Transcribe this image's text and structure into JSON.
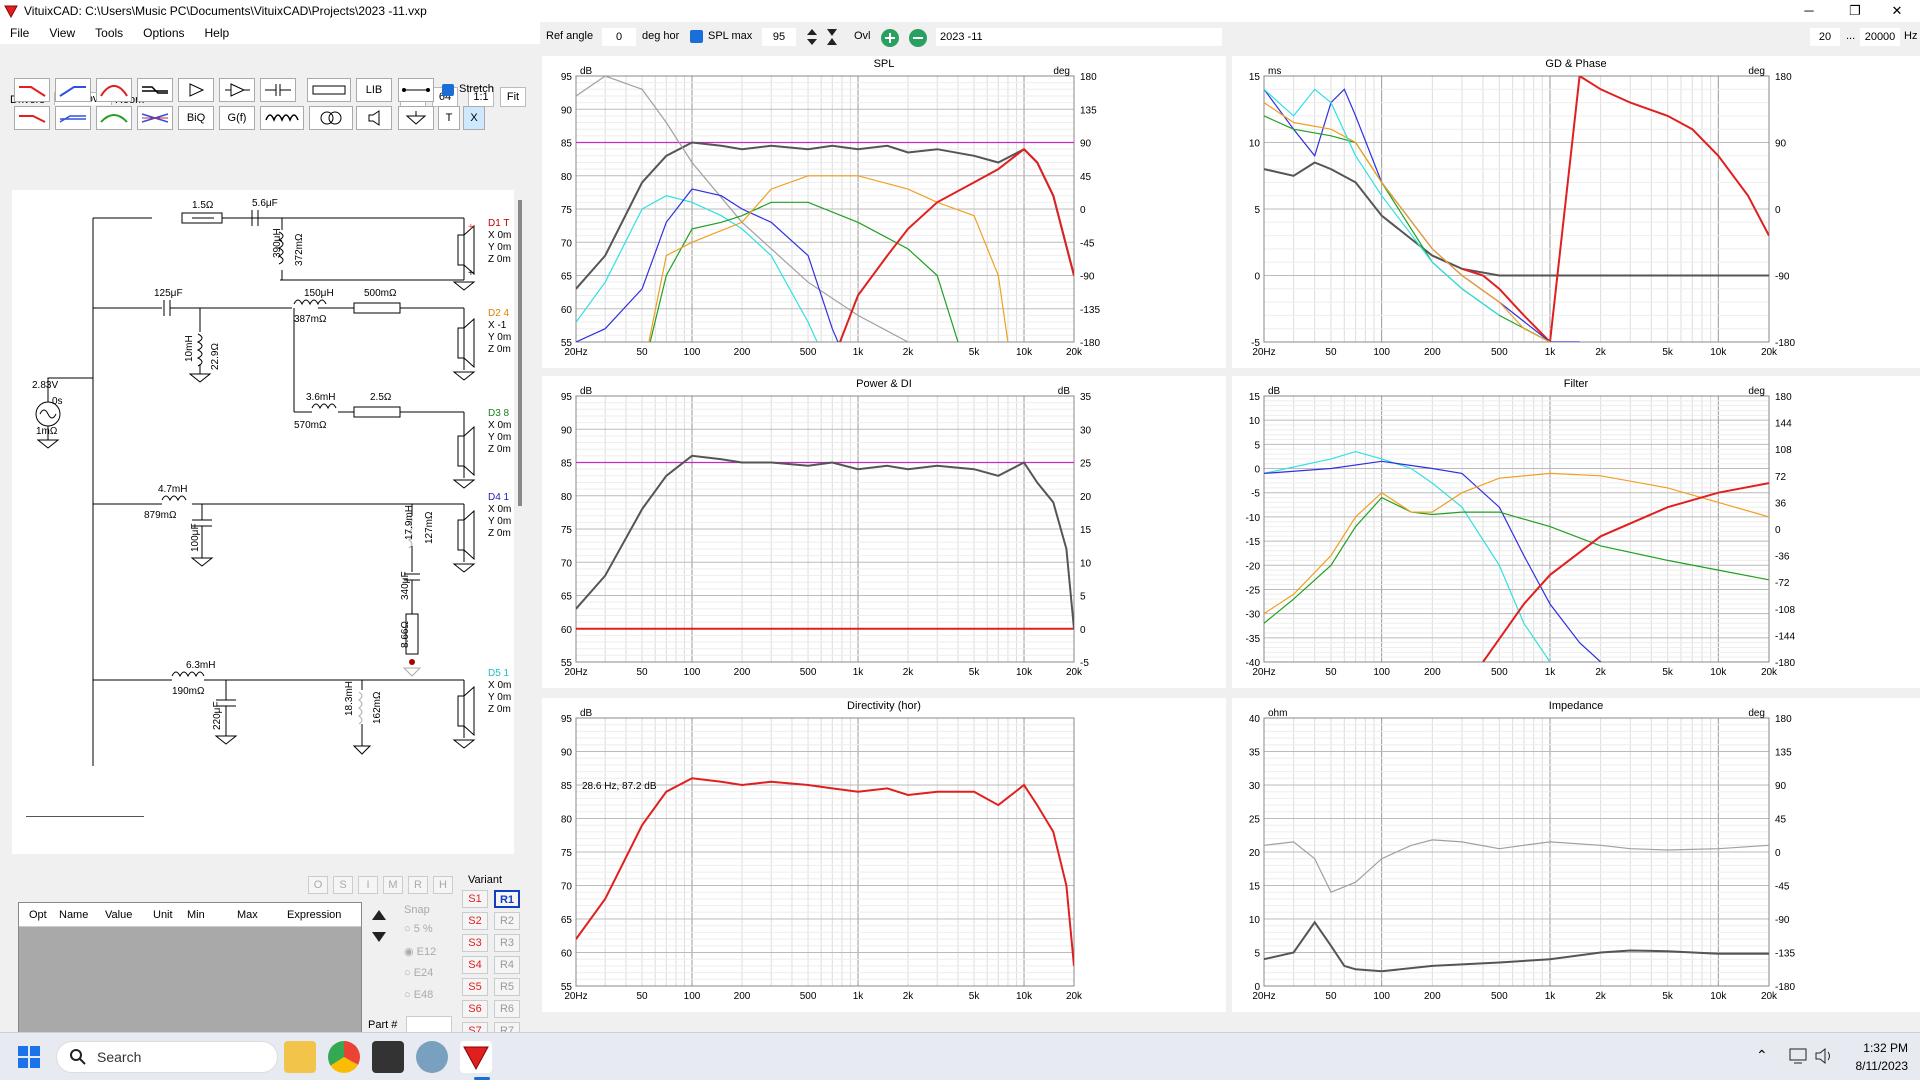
{
  "app": {
    "title": "VituixCAD: C:\\Users\\Music PC\\Documents\\VituixCAD\\Projects\\2023 -11.vxp",
    "min": "─",
    "max": "❐",
    "close": "✕"
  },
  "menu": [
    "File",
    "View",
    "Tools",
    "Options",
    "Help"
  ],
  "tabs": [
    "Drivers",
    "Crossover",
    "Room"
  ],
  "viewbtns": [
    "9",
    "64",
    "1:1",
    "Fit"
  ],
  "tools": {
    "lib": "LIB",
    "biq": "BiQ",
    "gf": "G(f)",
    "t": "T",
    "x": "X",
    "stretch": "Stretch"
  },
  "schematic": {
    "source": {
      "v": "2.83V",
      "t": "0s",
      "r": "1mΩ"
    },
    "d1": {
      "r": "1.5Ω",
      "c": "5.6μF",
      "l": "390μH",
      "lr": "372mΩ",
      "label": "D1 T",
      "xyz": [
        "X 0m",
        "Y 0m",
        "Z 0m"
      ]
    },
    "d2": {
      "c": "125μF",
      "l": "10mH",
      "lr": "22.9Ω",
      "l2": "150μH",
      "l2r": "387mΩ",
      "r": "500mΩ",
      "label": "D2 4",
      "xyz": [
        "X -1",
        "Y 0m",
        "Z 0m"
      ]
    },
    "d3": {
      "l": "3.6mH",
      "lr": "570mΩ",
      "r": "2.5Ω",
      "label": "D3 8",
      "xyz": [
        "X 0m",
        "Y 0m",
        "Z 0m"
      ]
    },
    "d4": {
      "l": "4.7mH",
      "lr": "879mΩ",
      "c": "100μF",
      "l2": "17.9mH",
      "l2r": "127mΩ",
      "c2": "340μF",
      "r": "8.66Ω",
      "label": "D4 1",
      "xyz": [
        "X 0m",
        "Y 0m",
        "Z 0m"
      ]
    },
    "d5": {
      "l": "6.3mH",
      "lr": "190mΩ",
      "c": "220μF",
      "l2": "18.3mH",
      "l2r": "162mΩ",
      "label": "D5 1",
      "xyz": [
        "X 0m",
        "Y 0m",
        "Z 0m"
      ]
    }
  },
  "opt": {
    "headers": [
      "Opt",
      "Name",
      "Value",
      "Unit",
      "Min",
      "Max",
      "Expression"
    ],
    "toggles": [
      "O",
      "S",
      "I",
      "M",
      "R",
      "H"
    ],
    "snap": "Snap",
    "snapopts": [
      "5 %",
      "E12",
      "E24",
      "E48"
    ],
    "part": "Part #",
    "variant": "Variant",
    "s": [
      "S1",
      "S2",
      "S3",
      "S4",
      "S5",
      "S6",
      "S7",
      "S8"
    ],
    "r": [
      "R1",
      "R2",
      "R3",
      "R4",
      "R5",
      "R6",
      "R7",
      "R8"
    ]
  },
  "toolbar": {
    "refangle_label": "Ref angle",
    "refangle": "0",
    "deghor": "deg hor",
    "splmax_label": "SPL max",
    "splmax": "95",
    "ovl": "Ovl",
    "name": "2023 -11",
    "fmin": "20",
    "dots": "...",
    "fmax": "20000",
    "hz": "Hz"
  },
  "colors": {
    "magenta": "#c030c0",
    "red": "#e02020",
    "darkgray": "#555",
    "gray": "#a0a0a0",
    "cyan": "#30e0e0",
    "blue": "#3030e0",
    "green": "#20a020",
    "orange": "#f0a020"
  },
  "chart_data": [
    {
      "type": "line",
      "title": "SPL",
      "ylabel": "dB",
      "y2label": "deg",
      "x_ticks": [
        "20Hz",
        "50",
        "100",
        "200",
        "500",
        "1k",
        "2k",
        "5k",
        "10k",
        "20k"
      ],
      "ylim": [
        55,
        95
      ],
      "y2lim": [
        -180,
        180
      ],
      "y_ticks": [
        "95",
        "90",
        "85",
        "80",
        "75",
        "70",
        "65",
        "60",
        "55"
      ],
      "y2_ticks": [
        "180",
        "135",
        "90",
        "45",
        "0",
        "-45",
        "-90",
        "-135",
        "-180"
      ],
      "series": [
        {
          "color": "#c030c0",
          "x": [
            20,
            20000
          ],
          "y": [
            85,
            85
          ]
        },
        {
          "color": "#555",
          "x": [
            20,
            30,
            50,
            70,
            100,
            150,
            200,
            300,
            500,
            700,
            1000,
            1500,
            2000,
            3000,
            5000,
            7000,
            10000,
            12000,
            15000,
            20000
          ],
          "y": [
            63,
            68,
            79,
            83,
            85,
            84.5,
            84,
            84.5,
            84,
            84.5,
            84,
            84.5,
            83.5,
            84,
            83,
            82,
            84,
            82,
            77,
            65
          ]
        },
        {
          "color": "#a0a0a0",
          "x": [
            20,
            30,
            50,
            70,
            100,
            200,
            500,
            1000,
            2000,
            5000,
            10000,
            15000,
            20000
          ],
          "y": [
            92,
            95,
            93,
            88,
            82,
            73,
            64,
            59,
            55,
            55,
            55,
            55,
            55
          ]
        },
        {
          "color": "#30e0e0",
          "x": [
            20,
            30,
            50,
            70,
            100,
            150,
            200,
            300,
            500,
            700
          ],
          "y": [
            58,
            64,
            75,
            77,
            76,
            74,
            72,
            68,
            58,
            50
          ]
        },
        {
          "color": "#3030e0",
          "x": [
            20,
            30,
            50,
            70,
            100,
            150,
            200,
            300,
            500,
            700,
            1000
          ],
          "y": [
            55,
            57,
            63,
            73,
            78,
            77,
            75,
            73,
            68,
            57,
            48
          ]
        },
        {
          "color": "#20a020",
          "x": [
            20,
            50,
            70,
            100,
            150,
            200,
            300,
            500,
            1000,
            2000,
            3000,
            4000,
            5000
          ],
          "y": [
            30,
            50,
            65,
            72,
            73,
            74,
            76,
            76,
            73,
            69,
            65,
            55,
            45
          ]
        },
        {
          "color": "#f0a020",
          "x": [
            50,
            70,
            100,
            200,
            300,
            500,
            700,
            1000,
            2000,
            3000,
            5000,
            7000,
            8000,
            10000
          ],
          "y": [
            50,
            68,
            70,
            73,
            78,
            80,
            80,
            80,
            78,
            76,
            74,
            65,
            55,
            45
          ]
        },
        {
          "color": "#e02020",
          "x": [
            600,
            700,
            1000,
            1500,
            2000,
            3000,
            5000,
            7000,
            10000,
            12000,
            15000,
            20000
          ],
          "y": [
            48,
            52,
            62,
            68,
            72,
            76,
            79,
            81,
            84,
            82,
            77,
            65
          ]
        }
      ]
    },
    {
      "type": "line",
      "title": "GD & Phase",
      "ylabel": "ms",
      "y2label": "deg",
      "x_ticks": [
        "20Hz",
        "50",
        "100",
        "200",
        "500",
        "1k",
        "2k",
        "5k",
        "10k",
        "20k"
      ],
      "ylim": [
        -5,
        15
      ],
      "y2lim": [
        -180,
        180
      ],
      "y_ticks": [
        "15",
        "10",
        "5",
        "0",
        "-5"
      ],
      "y2_ticks": [
        "180",
        "90",
        "0",
        "-90",
        "-180"
      ],
      "series": [
        {
          "color": "#555",
          "x": [
            20,
            30,
            40,
            50,
            70,
            100,
            200,
            300,
            500,
            700,
            1000,
            2000,
            5000,
            10000,
            20000
          ],
          "y": [
            8,
            7.5,
            8.5,
            8,
            7,
            4.5,
            1.5,
            0.5,
            0,
            0,
            0,
            0,
            0,
            0,
            0
          ]
        },
        {
          "color": "#e02020",
          "x": [
            300,
            400,
            500,
            700,
            1000,
            1500,
            2000,
            3000,
            5000,
            7000,
            10000,
            15000,
            20000
          ],
          "y": [
            0.5,
            0,
            -1,
            -3,
            -5,
            15,
            14,
            13,
            12,
            11,
            9,
            6,
            3
          ]
        },
        {
          "color": "#3030e0",
          "x": [
            20,
            30,
            40,
            50,
            60,
            70,
            100,
            200,
            300,
            500,
            1000,
            1500
          ],
          "y": [
            14,
            11,
            9,
            13,
            14,
            12,
            7,
            2,
            0,
            -2,
            -5,
            -5
          ]
        },
        {
          "color": "#20a020",
          "x": [
            20,
            30,
            50,
            70,
            100,
            200,
            300,
            500,
            1000
          ],
          "y": [
            12,
            11,
            10.5,
            10,
            7,
            1,
            -1,
            -3,
            -5
          ]
        },
        {
          "color": "#f0a020",
          "x": [
            20,
            30,
            50,
            70,
            100,
            200,
            300,
            500,
            700,
            1000
          ],
          "y": [
            13,
            11.5,
            11,
            10,
            7,
            2,
            0,
            -2,
            -4,
            -5
          ]
        },
        {
          "color": "#30e0e0",
          "x": [
            20,
            30,
            40,
            50,
            70,
            100,
            200,
            300,
            500
          ],
          "y": [
            14,
            12,
            14,
            13,
            9,
            6,
            1,
            -1,
            -3
          ]
        }
      ]
    },
    {
      "type": "line",
      "title": "Power & DI",
      "ylabel": "dB",
      "y2label": "dB",
      "x_ticks": [
        "20Hz",
        "50",
        "100",
        "200",
        "500",
        "1k",
        "2k",
        "5k",
        "10k",
        "20k"
      ],
      "ylim": [
        55,
        95
      ],
      "y2lim": [
        -5,
        35
      ],
      "y_ticks": [
        "95",
        "90",
        "85",
        "80",
        "75",
        "70",
        "65",
        "60",
        "55"
      ],
      "y2_ticks": [
        "35",
        "30",
        "25",
        "20",
        "15",
        "10",
        "5",
        "0",
        "-5"
      ],
      "series": [
        {
          "color": "#c030c0",
          "x": [
            20,
            20000
          ],
          "y": [
            85,
            85
          ]
        },
        {
          "color": "#e02020",
          "x": [
            20,
            20000
          ],
          "y": [
            60,
            60
          ]
        },
        {
          "color": "#555",
          "x": [
            20,
            30,
            50,
            70,
            100,
            150,
            200,
            300,
            500,
            700,
            1000,
            1500,
            2000,
            3000,
            5000,
            7000,
            10000,
            12000,
            15000,
            18000,
            20000
          ],
          "y": [
            63,
            68,
            78,
            83,
            86,
            85.5,
            85,
            85,
            84.5,
            85,
            84,
            84.5,
            84,
            84.5,
            84,
            83,
            85,
            82,
            79,
            72,
            60
          ]
        }
      ]
    },
    {
      "type": "line",
      "title": "Filter",
      "ylabel": "dB",
      "y2label": "deg",
      "x_ticks": [
        "20Hz",
        "50",
        "100",
        "200",
        "500",
        "1k",
        "2k",
        "5k",
        "10k",
        "20k"
      ],
      "ylim": [
        -40,
        15
      ],
      "y2lim": [
        -180,
        180
      ],
      "y_ticks": [
        "15",
        "10",
        "5",
        "0",
        "-5",
        "-10",
        "-15",
        "-20",
        "-25",
        "-30",
        "-35",
        "-40"
      ],
      "y2_ticks": [
        "180",
        "144",
        "108",
        "72",
        "36",
        "0",
        "-36",
        "-72",
        "-108",
        "-144",
        "-180"
      ],
      "series": [
        {
          "color": "#30e0e0",
          "x": [
            20,
            50,
            70,
            100,
            150,
            200,
            300,
            500,
            700,
            1000
          ],
          "y": [
            -1,
            2,
            3.5,
            2,
            0,
            -3,
            -8,
            -20,
            -32,
            -40
          ]
        },
        {
          "color": "#3030e0",
          "x": [
            20,
            50,
            100,
            200,
            300,
            500,
            700,
            1000,
            1500,
            2000
          ],
          "y": [
            -1,
            0,
            1.5,
            0,
            -1,
            -8,
            -18,
            -28,
            -36,
            -40
          ]
        },
        {
          "color": "#20a020",
          "x": [
            20,
            30,
            50,
            70,
            100,
            150,
            200,
            300,
            500,
            1000,
            2000,
            5000,
            10000,
            20000
          ],
          "y": [
            -32,
            -27,
            -20,
            -12,
            -6,
            -9,
            -9.5,
            -9,
            -9,
            -12,
            -16,
            -19,
            -21,
            -23
          ]
        },
        {
          "color": "#f0a020",
          "x": [
            20,
            30,
            50,
            70,
            100,
            150,
            200,
            300,
            500,
            1000,
            2000,
            5000,
            10000,
            20000
          ],
          "y": [
            -30,
            -26,
            -18,
            -10,
            -5,
            -9,
            -9,
            -5,
            -2,
            -1,
            -1.5,
            -4,
            -7,
            -10
          ]
        },
        {
          "color": "#e02020",
          "x": [
            400,
            700,
            1000,
            2000,
            5000,
            10000,
            20000
          ],
          "y": [
            -40,
            -28,
            -22,
            -14,
            -8,
            -5,
            -3
          ]
        }
      ]
    },
    {
      "type": "line",
      "title": "Directivity (hor)",
      "ylabel": "dB",
      "x_ticks": [
        "20Hz",
        "50",
        "100",
        "200",
        "500",
        "1k",
        "2k",
        "5k",
        "10k",
        "20k"
      ],
      "ylim": [
        55,
        95
      ],
      "y_ticks": [
        "95",
        "90",
        "85",
        "80",
        "75",
        "70",
        "65",
        "60",
        "55"
      ],
      "annotation": "28.6 Hz, 87.2 dB",
      "series": [
        {
          "color": "#e02020",
          "x": [
            20,
            30,
            50,
            70,
            100,
            150,
            200,
            300,
            500,
            700,
            1000,
            1500,
            2000,
            3000,
            5000,
            7000,
            10000,
            12000,
            15000,
            18000,
            20000
          ],
          "y": [
            62,
            68,
            79,
            84,
            86,
            85.5,
            85,
            85.5,
            85,
            84.5,
            84,
            84.5,
            83.5,
            84,
            84,
            82,
            85,
            82,
            78,
            70,
            58
          ]
        }
      ]
    },
    {
      "type": "line",
      "title": "Impedance",
      "ylabel": "ohm",
      "y2label": "deg",
      "x_ticks": [
        "20Hz",
        "50",
        "100",
        "200",
        "500",
        "1k",
        "2k",
        "5k",
        "10k",
        "20k"
      ],
      "ylim": [
        0,
        40
      ],
      "y2lim": [
        -180,
        180
      ],
      "y_ticks": [
        "40",
        "35",
        "30",
        "25",
        "20",
        "15",
        "10",
        "5",
        "0"
      ],
      "y2_ticks": [
        "180",
        "135",
        "90",
        "45",
        "0",
        "-45",
        "-90",
        "-135",
        "-180"
      ],
      "series": [
        {
          "color": "#a0a0a0",
          "x": [
            20,
            30,
            40,
            50,
            70,
            100,
            150,
            200,
            300,
            500,
            700,
            1000,
            2000,
            3000,
            5000,
            10000,
            20000
          ],
          "y": [
            21,
            21.5,
            19,
            14,
            15.5,
            19,
            21,
            21.8,
            21.5,
            20.5,
            21,
            21.5,
            21,
            20.5,
            20.3,
            20.5,
            21
          ]
        },
        {
          "color": "#555",
          "x": [
            20,
            30,
            40,
            50,
            60,
            70,
            100,
            200,
            500,
            1000,
            2000,
            3000,
            5000,
            10000,
            20000
          ],
          "y": [
            4,
            5,
            9.5,
            6,
            3,
            2.5,
            2.2,
            3,
            3.5,
            4,
            5,
            5.3,
            5.2,
            4.8,
            4.8
          ]
        }
      ]
    }
  ],
  "taskbar": {
    "search": "Search",
    "time": "1:32 PM",
    "date": "8/11/2023"
  }
}
